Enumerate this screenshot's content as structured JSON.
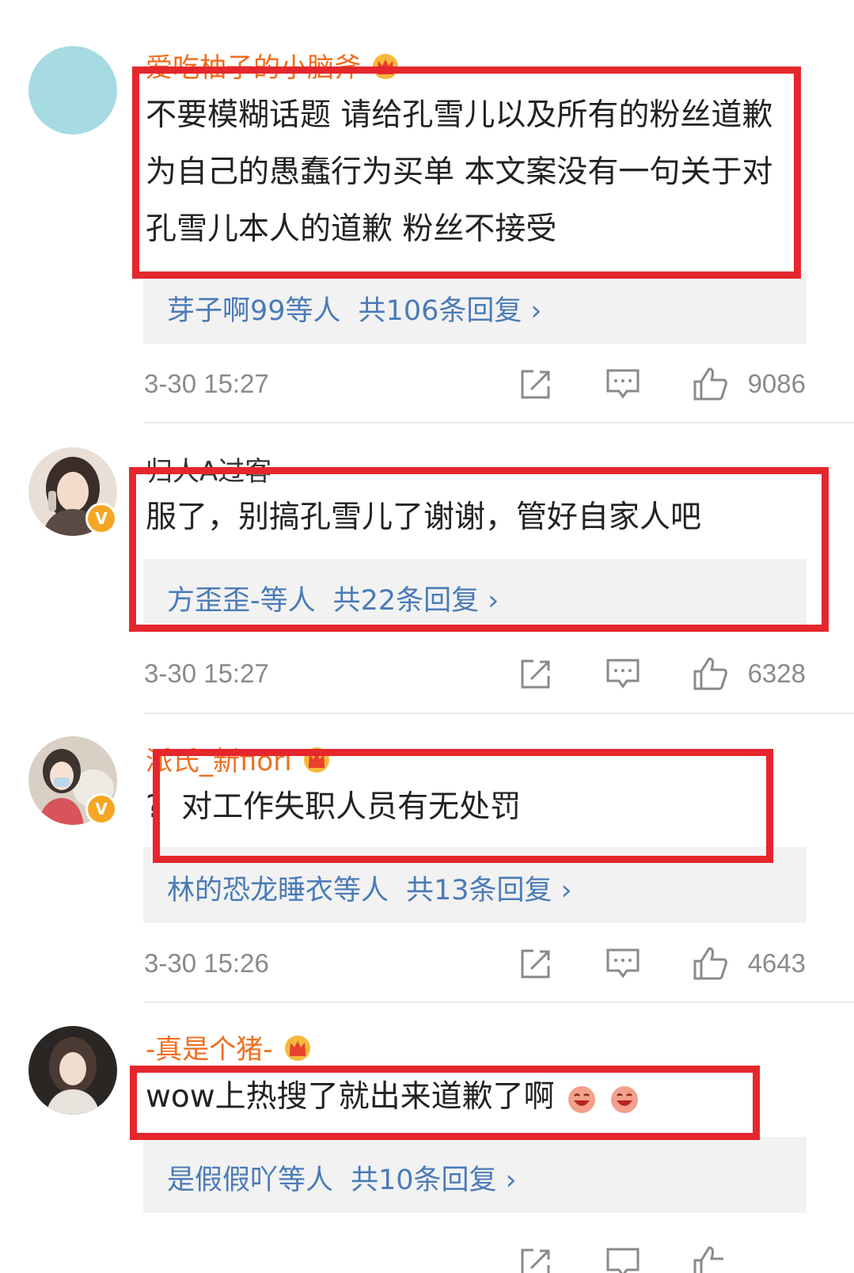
{
  "comments": [
    {
      "username": "爱吃柚子的小脑斧",
      "text": "不要模糊话题 请给孔雪儿以及所有的粉丝道歉 为自己的愚蠢行为买单 本文案没有一句关于对孔雪儿本人的道歉 粉丝不接受",
      "reply_users": "芽子啊99等人",
      "reply_count": "共106条回复 ›",
      "time": "3-30 15:27",
      "likes": "9086"
    },
    {
      "username": "归人A过客",
      "text": "服了，别搞孔雪儿了谢谢，管好自家人吧",
      "reply_users": "方歪歪-等人",
      "reply_count": "共22条回复 ›",
      "time": "3-30 15:27",
      "likes": "6328"
    },
    {
      "username": "派氏_新fiori",
      "text_prefix": "?",
      "text": "对工作失职人员有无处罚",
      "reply_users": "林的恐龙睡衣等人",
      "reply_count": "共13条回复 ›",
      "time": "3-30 15:26",
      "likes": "4643"
    },
    {
      "username": "-真是个猪-",
      "text": "wow上热搜了就出来道歉了啊",
      "reply_users": "是假假吖等人",
      "reply_count": "共10条回复 ›"
    }
  ],
  "icons": {
    "share": "share-icon",
    "comment": "comment-icon",
    "like": "thumbs-up-icon",
    "crown": "crown-icon",
    "verified": "verified-v-icon",
    "emoji": "laughing-emoji-icon"
  },
  "colors": {
    "username": "#f06e1d",
    "reply_link": "#4a7bb7",
    "highlight_box": "#e5262d",
    "reply_bg": "#f2f2f2",
    "meta_text": "#8a8a8a"
  }
}
